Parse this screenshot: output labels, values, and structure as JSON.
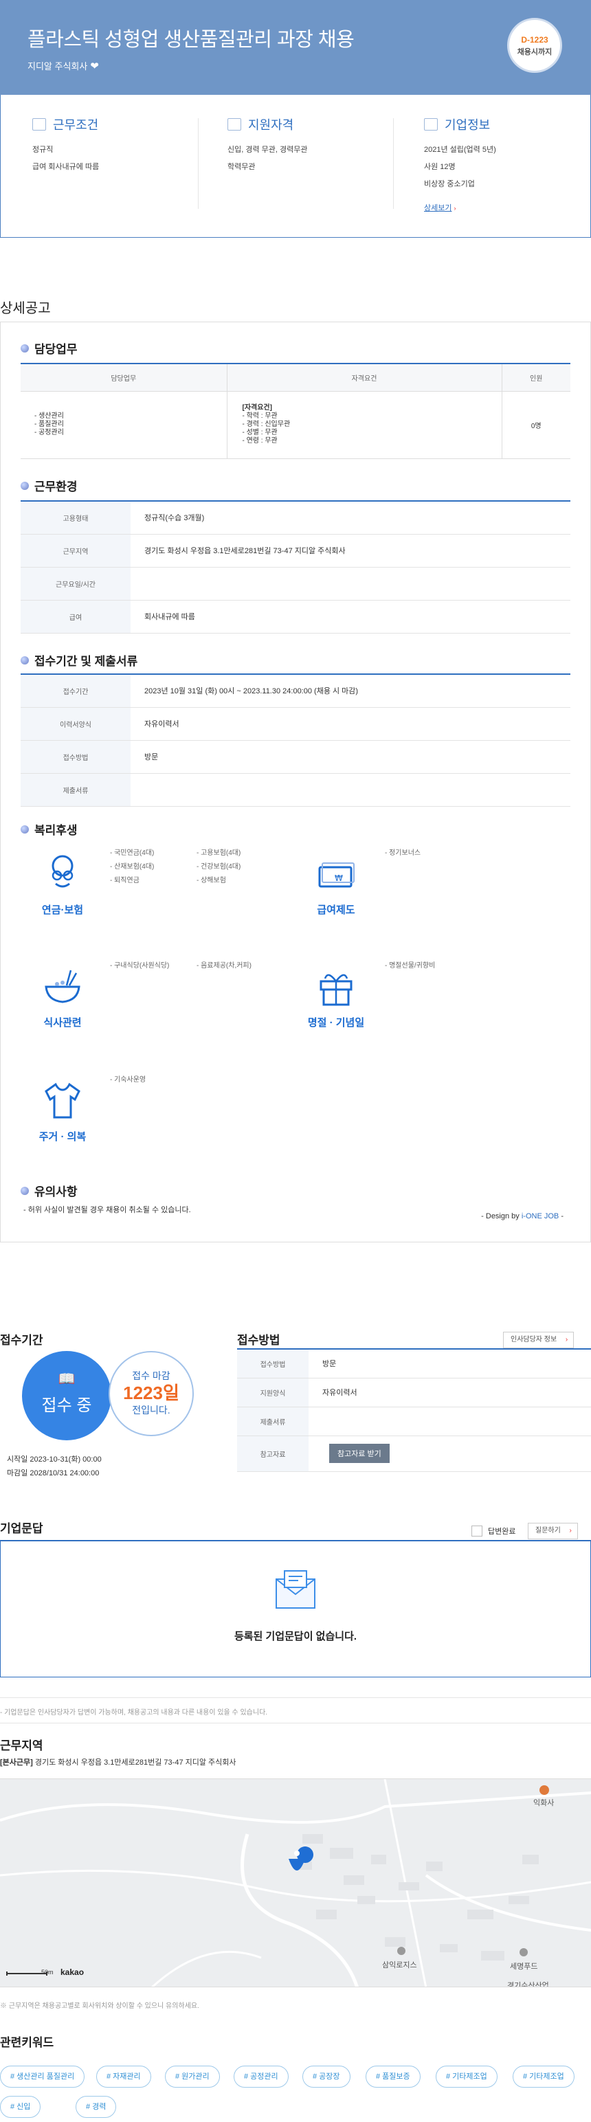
{
  "header": {
    "title": "플라스틱 성형업 생산품질관리 과장 채용",
    "company": "지디알 주식회사",
    "dday": "D-1223",
    "dday_label": "채용시까지"
  },
  "summary": {
    "work": {
      "title": "근무조건",
      "items": [
        "정규직",
        "급여 회사내규에 따름"
      ]
    },
    "qualification": {
      "title": "지원자격",
      "items": [
        "신입, 경력 무관, 경력무관",
        "학력무관"
      ]
    },
    "company": {
      "title": "기업정보",
      "items": [
        "2021년 설립(업력 5년)",
        "사원 12명",
        "비상장 중소기업"
      ],
      "more": "상세보기"
    }
  },
  "detail": {
    "title": "상세공고",
    "duty": {
      "title": "담당업무",
      "headers": [
        "담당업무",
        "자격요건",
        "인원"
      ],
      "tasks": [
        "- 생산관리",
        "- 품질관리",
        "- 공정관리"
      ],
      "req_title": "[자격요건]",
      "requirements": [
        "- 학력 : 무관",
        "- 경력 : 신입무관",
        "- 성별 : 무관",
        "- 연령 : 무관"
      ],
      "count": "0명"
    },
    "env": {
      "title": "근무환경",
      "rows": [
        {
          "k": "고용형태",
          "v": "정규직(수습 3개월)"
        },
        {
          "k": "근무지역",
          "v": "경기도 화성시 우정읍 3.1만세로281번길 73-47 지디알 주식회사"
        },
        {
          "k": "근무요일/시간",
          "v": ""
        },
        {
          "k": "급여",
          "v": "회사내규에 따름"
        }
      ]
    },
    "apply": {
      "title": "접수기간 및 제출서류",
      "rows": [
        {
          "k": "접수기간",
          "v": "2023년 10월 31일 (화) 00시 ~ 2023.11.30 24:00:00 (채용 시 마감)"
        },
        {
          "k": "이력서양식",
          "v": "자유이력서"
        },
        {
          "k": "접수방법",
          "v": "방문"
        },
        {
          "k": "제출서류",
          "v": ""
        }
      ]
    },
    "welfare": {
      "title": "복리후생",
      "pension": {
        "label": "연금·보험",
        "items": [
          "- 국민연금(4대)",
          "- 고용보험(4대)",
          "- 산재보험(4대)",
          "- 건강보험(4대)",
          "- 퇴직연금",
          "- 상해보험"
        ]
      },
      "salary": {
        "label": "급여제도",
        "items": [
          "- 정기보너스"
        ]
      },
      "meal": {
        "label": "식사관련",
        "items": [
          "- 구내식당(사원식당)",
          "- 음료제공(차,커피)"
        ]
      },
      "holiday": {
        "label": "명절 · 기념일",
        "items": [
          "- 명절선물/귀향비"
        ]
      },
      "housing": {
        "label": "주거 · 의복",
        "items": [
          "- 기숙사운영"
        ]
      }
    },
    "notice": {
      "title": "유의사항",
      "text": "- 허위 사실이 발견될 경우 채용이 취소될 수 있습니다."
    },
    "design": {
      "prefix": "- Design by ",
      "brand": "i-ONE JOB",
      "suffix": " -"
    }
  },
  "application": {
    "period_title": "접수기간",
    "status": "접수 중",
    "deadline_label": "접수 마감",
    "days": "1223일",
    "days_suffix": "전입니다.",
    "start": "시작일 2023-10-31(화) 00:00",
    "end": "마감일 2028/10/31 24:00:00",
    "method_title": "접수방법",
    "hr_button": "인사담당자 정보",
    "rows": [
      {
        "k": "접수방법",
        "v": "방문"
      },
      {
        "k": "지원양식",
        "v": "자유이력서"
      },
      {
        "k": "제출서류",
        "v": ""
      },
      {
        "k": "참고자료",
        "v": ""
      }
    ],
    "ref_button": "참고자료 받기"
  },
  "qna": {
    "title": "기업문답",
    "answered": "답변완료",
    "ask_button": "질문하기",
    "empty": "등록된 기업문답이 없습니다.",
    "disclaimer": "- 기업문답은 인사담당자가 답변이 가능하며, 채용공고의 내용과 다른 내용이 있을 수 있습니다."
  },
  "location": {
    "title": "근무지역",
    "tag": "[본사근무]",
    "address": "경기도 화성시 우정읍 3.1만세로281번길 73-47 지디알 주식회사",
    "map_labels": [
      "익화사",
      "삼익로지스",
      "세명푸드",
      "경기수산산업"
    ],
    "scale": "50m",
    "kakao": "kakao",
    "note": "※ 근무지역은 채용공고별로 회사위치와 상이할 수 있으니 유의하세요."
  },
  "keywords": {
    "title": "관련키워드",
    "items": [
      "# 생산관리 품질관리",
      "# 자재관리",
      "# 원가관리",
      "# 공정관리",
      "# 공장장",
      "# 품질보증",
      "# 기타제조업",
      "# 기타제조업",
      "# 신입",
      "# 경력"
    ]
  },
  "colors": {
    "accent": "#2f6fc0",
    "hero": "#6f96c7",
    "orange": "#ef6a25"
  }
}
